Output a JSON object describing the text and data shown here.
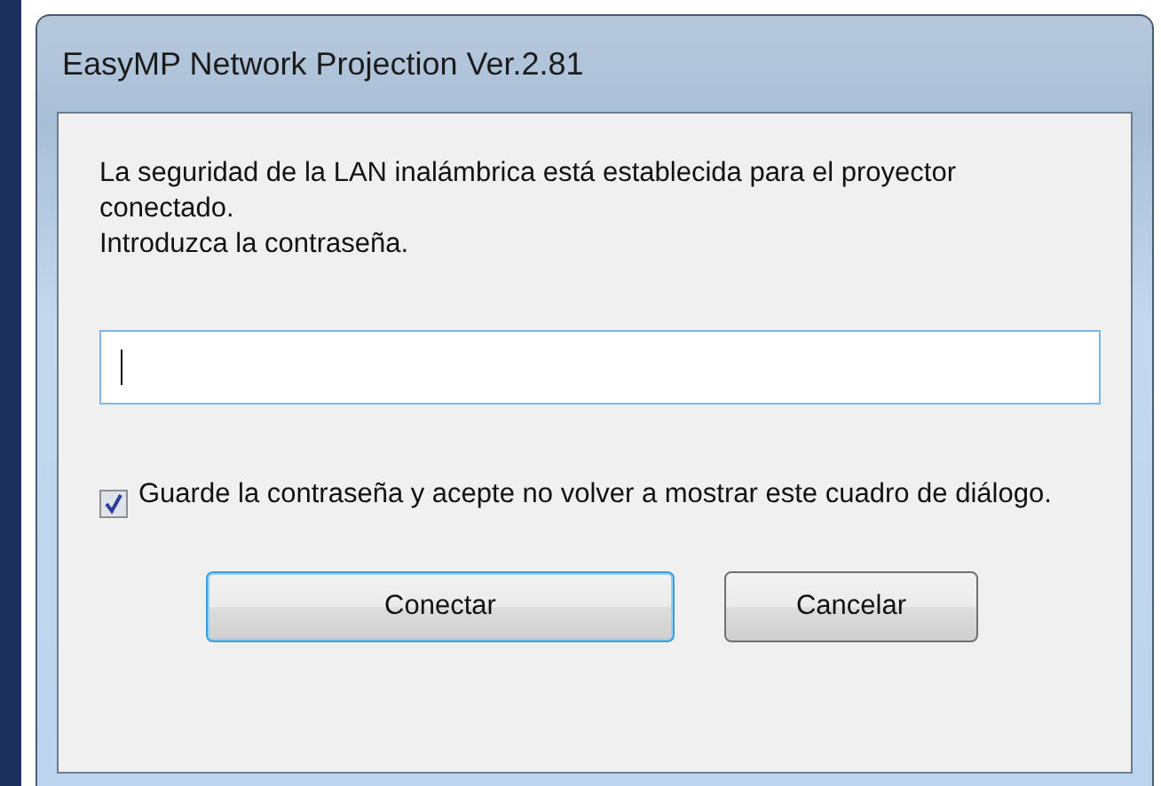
{
  "window": {
    "title": "EasyMP Network Projection Ver.2.81"
  },
  "message": [
    "La seguridad de la LAN inalámbrica está establecida para el proyector conectado.",
    "Introduzca la contraseña."
  ],
  "password": {
    "focused": true
  },
  "remember": {
    "label": "Guarde la contraseña y acepte no volver a mostrar este cuadro de diálogo.",
    "checked": true
  },
  "buttons": [
    {
      "label": "Conectar",
      "default": true
    },
    {
      "label": "Cancelar",
      "default": false
    }
  ]
}
